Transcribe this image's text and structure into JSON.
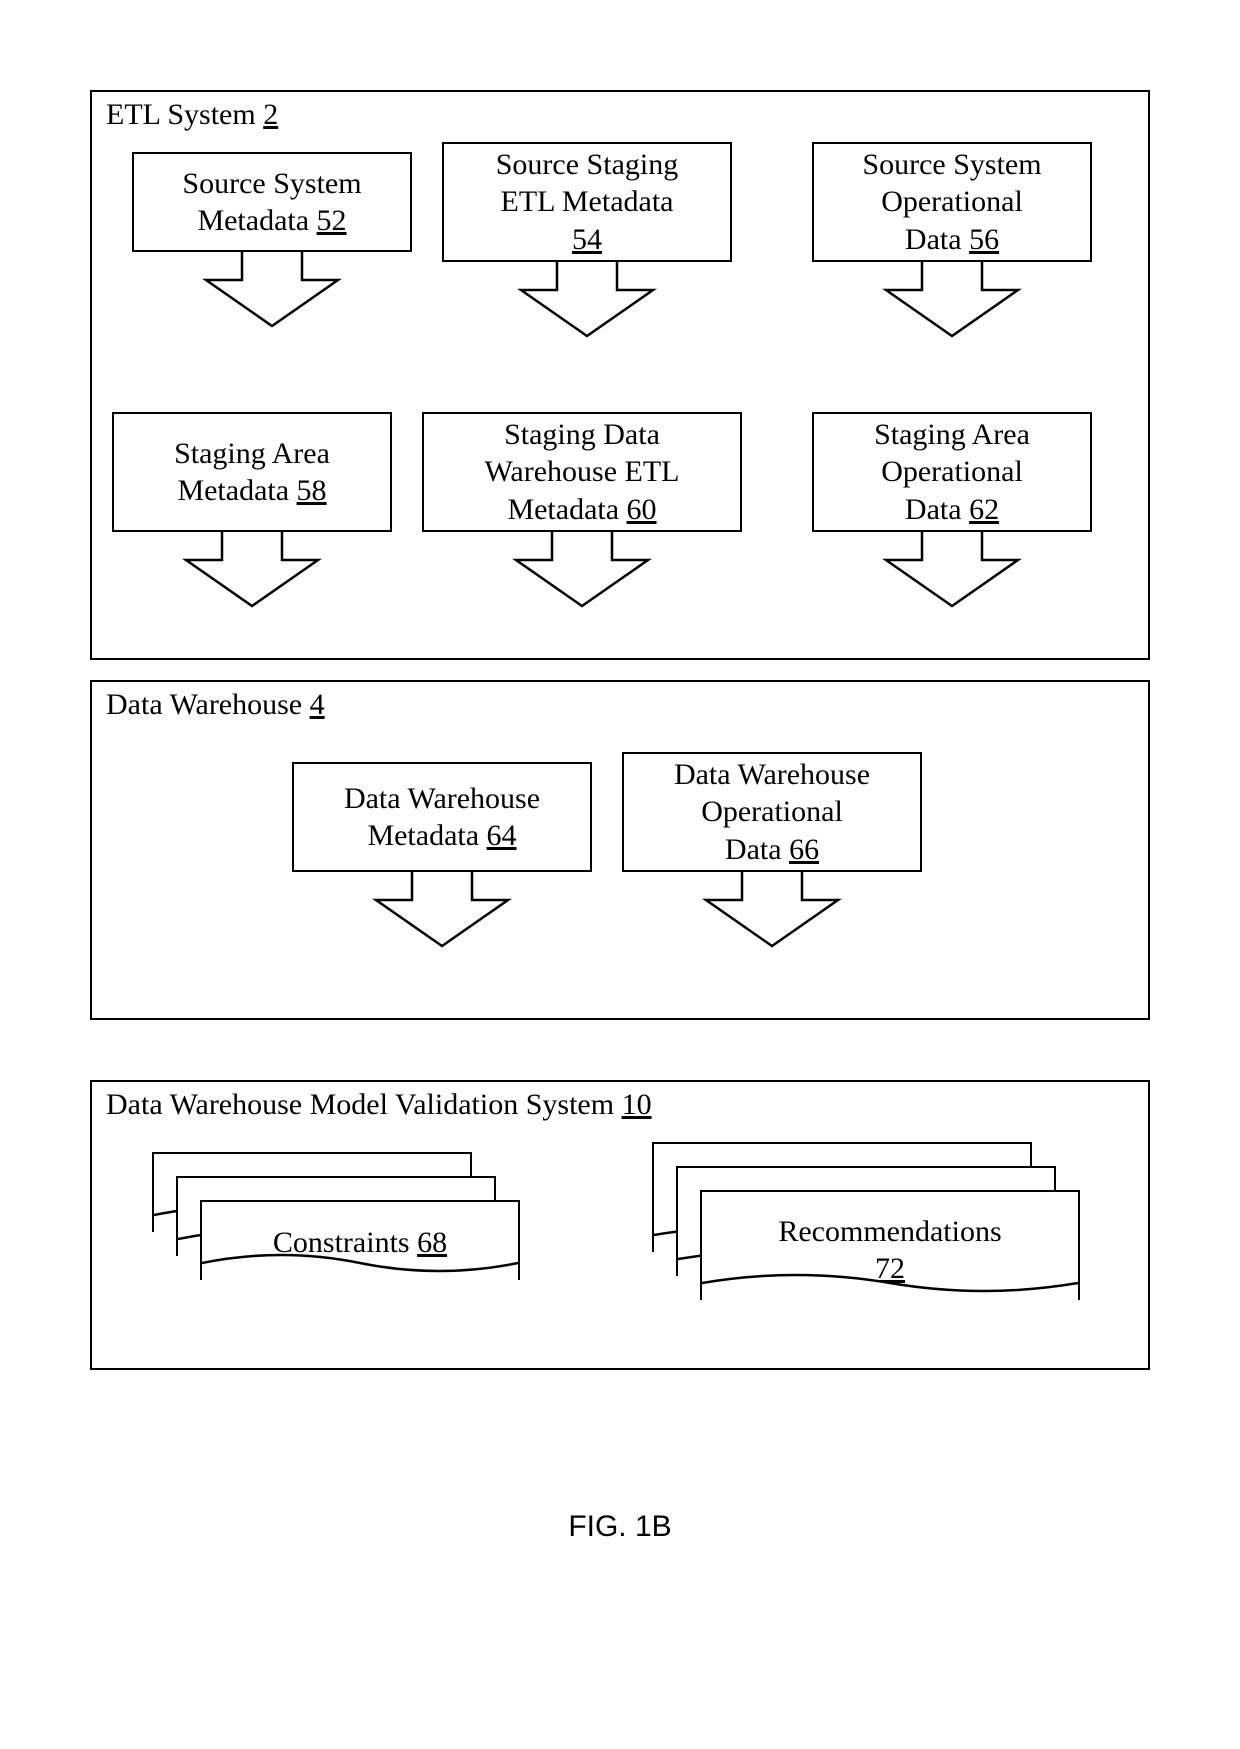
{
  "etl": {
    "title": "ETL System",
    "ref": "2",
    "boxes": {
      "b52_l1": "Source System",
      "b52_l2": "Metadata",
      "b52_ref": "52",
      "b54_l1": "Source Staging",
      "b54_l2": "ETL Metadata",
      "b54_ref": "54",
      "b56_l1": "Source System",
      "b56_l2": "Operational",
      "b56_l3": "Data",
      "b56_ref": "56",
      "b58_l1": "Staging Area",
      "b58_l2": "Metadata",
      "b58_ref": "58",
      "b60_l1": "Staging Data",
      "b60_l2": "Warehouse ETL",
      "b60_l3": "Metadata",
      "b60_ref": "60",
      "b62_l1": "Staging Area",
      "b62_l2": "Operational",
      "b62_l3": "Data",
      "b62_ref": "62"
    }
  },
  "dw": {
    "title": "Data Warehouse",
    "ref": "4",
    "boxes": {
      "b64_l1": "Data Warehouse",
      "b64_l2": "Metadata",
      "b64_ref": "64",
      "b66_l1": "Data Warehouse",
      "b66_l2": "Operational",
      "b66_l3": "Data",
      "b66_ref": "66"
    }
  },
  "valid": {
    "title": "Data Warehouse Model Validation System",
    "ref": "10",
    "docs": {
      "c_label": "Constraints",
      "c_ref": "68",
      "r_label": "Recommendations",
      "r_ref": "72"
    }
  },
  "caption": "FIG. 1B"
}
